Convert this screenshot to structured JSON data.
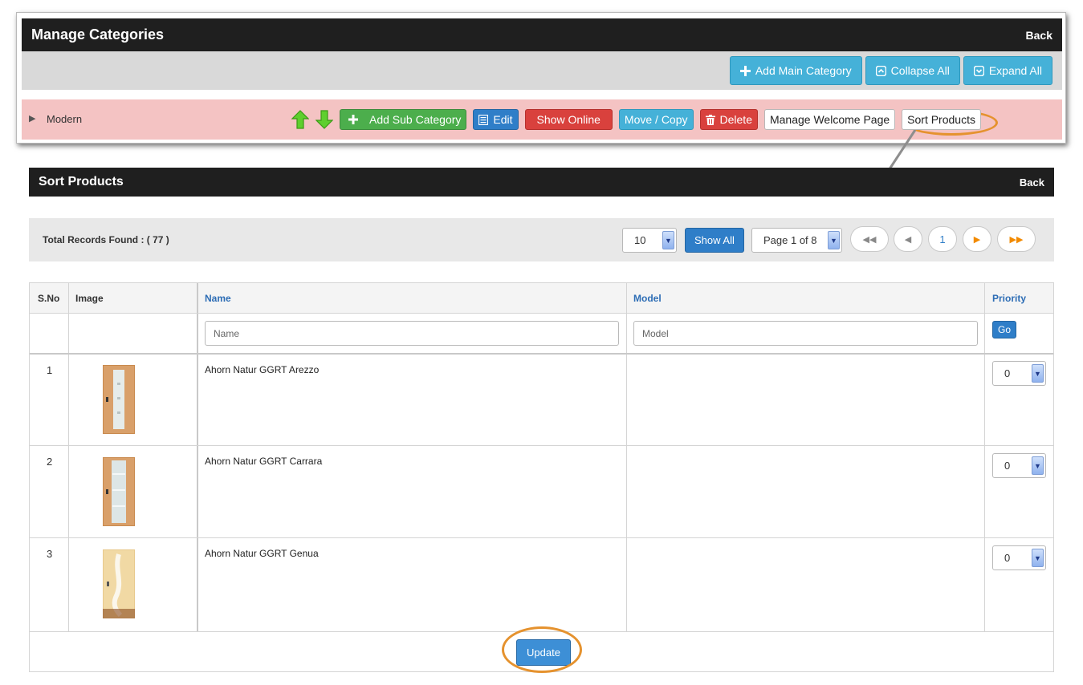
{
  "manage": {
    "title": "Manage Categories",
    "back": "Back",
    "add_main": "Add Main Category",
    "collapse_all": "Collapse All",
    "expand_all": "Expand All",
    "category": {
      "name": "Modern",
      "actions": {
        "add_sub": "Add Sub Category",
        "edit": "Edit",
        "show_online": "Show Online",
        "move_copy": "Move / Copy",
        "delete": "Delete",
        "welcome": "Manage Welcome Page",
        "sort": "Sort Products"
      }
    }
  },
  "sort": {
    "title": "Sort Products",
    "back": "Back",
    "total": "Total Records Found : ( 77 )",
    "per_page": "10",
    "show_all": "Show All",
    "page_select": "Page 1 of 8",
    "current_page": "1",
    "columns": {
      "sno": "S.No",
      "image": "Image",
      "name": "Name",
      "model": "Model",
      "priority": "Priority"
    },
    "filters": {
      "name_placeholder": "Name",
      "model_placeholder": "Model",
      "go": "Go"
    },
    "rows": [
      {
        "sno": "1",
        "name": "Ahorn Natur GGRT Arezzo",
        "priority": "0"
      },
      {
        "sno": "2",
        "name": "Ahorn Natur GGRT Carrara",
        "priority": "0"
      },
      {
        "sno": "3",
        "name": "Ahorn Natur GGRT Genua",
        "priority": "0"
      }
    ],
    "update": "Update"
  },
  "colors": {
    "highlight": "#e5922e",
    "info": "#45b1d8",
    "success": "#4cae4c",
    "primary": "#2f7ec8",
    "danger": "#d9413d",
    "category_row": "#f4c3c3"
  }
}
